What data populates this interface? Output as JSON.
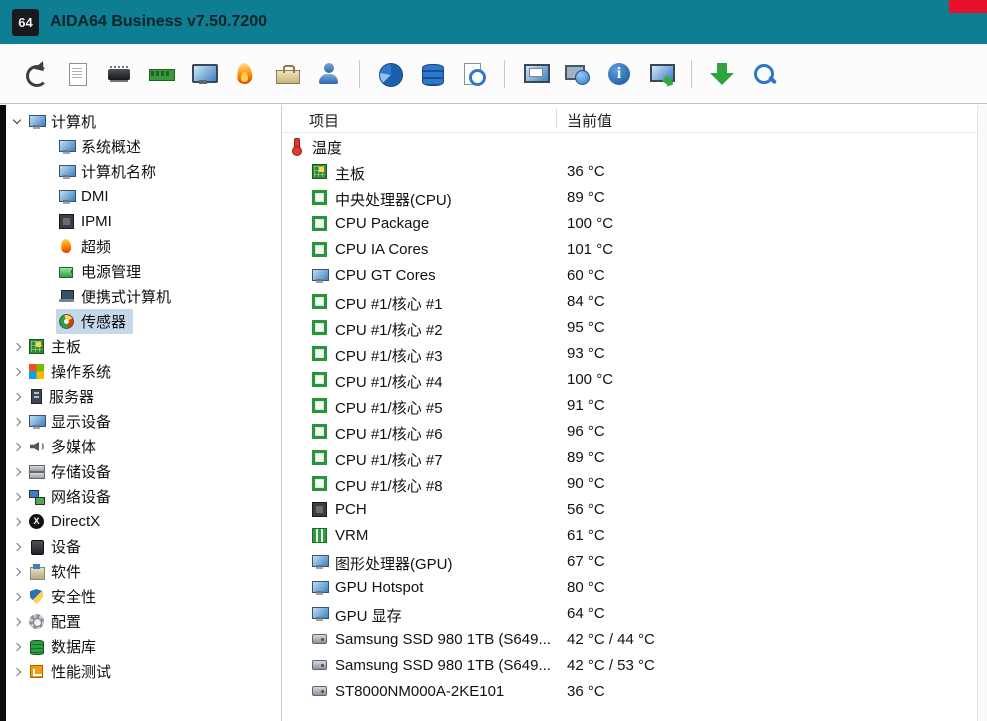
{
  "window": {
    "logo_text": "64",
    "title": "AIDA64 Business v7.50.7200"
  },
  "toolbar": {
    "items": [
      {
        "type": "button",
        "name": "refresh",
        "icon": "refresh-icon"
      },
      {
        "type": "button",
        "name": "report",
        "icon": "report-icon"
      },
      {
        "type": "button",
        "name": "chipset",
        "icon": "chip-icon"
      },
      {
        "type": "button",
        "name": "memory",
        "icon": "memory-module-icon"
      },
      {
        "type": "button",
        "name": "display",
        "icon": "monitor-icon"
      },
      {
        "type": "button",
        "name": "overclock",
        "icon": "flame-icon"
      },
      {
        "type": "button",
        "name": "toolbox",
        "icon": "toolbox-icon"
      },
      {
        "type": "button",
        "name": "users",
        "icon": "users-icon"
      },
      {
        "type": "separator"
      },
      {
        "type": "button",
        "name": "disk",
        "icon": "disk-pie-icon"
      },
      {
        "type": "button",
        "name": "database",
        "icon": "database-icon"
      },
      {
        "type": "button",
        "name": "scheduled-report",
        "icon": "report-clock-icon"
      },
      {
        "type": "separator"
      },
      {
        "type": "button",
        "name": "remote-monitor",
        "icon": "remote-monitor-icon"
      },
      {
        "type": "button",
        "name": "web",
        "icon": "web-globe-icon"
      },
      {
        "type": "button",
        "name": "info",
        "icon": "info-icon"
      },
      {
        "type": "button",
        "name": "remote-control",
        "icon": "monitor-arrow-icon"
      },
      {
        "type": "separator"
      },
      {
        "type": "button",
        "name": "update",
        "icon": "download-arrow-icon"
      },
      {
        "type": "button",
        "name": "search",
        "icon": "search-icon"
      }
    ]
  },
  "sidebar": {
    "items": [
      {
        "id": "computer",
        "label": "计算机",
        "level": 0,
        "arrow": "expanded",
        "icon": "monitor",
        "selected": false
      },
      {
        "id": "system-overview",
        "label": "系统概述",
        "level": 1,
        "arrow": "none",
        "icon": "monitor",
        "selected": false
      },
      {
        "id": "computer-name",
        "label": "计算机名称",
        "level": 1,
        "arrow": "none",
        "icon": "monitor",
        "selected": false
      },
      {
        "id": "dmi",
        "label": "DMI",
        "level": 1,
        "arrow": "none",
        "icon": "monitor",
        "selected": false
      },
      {
        "id": "ipmi",
        "label": "IPMI",
        "level": 1,
        "arrow": "none",
        "icon": "chip",
        "selected": false
      },
      {
        "id": "overclock",
        "label": "超频",
        "level": 1,
        "arrow": "none",
        "icon": "flame",
        "selected": false
      },
      {
        "id": "power-management",
        "label": "电源管理",
        "level": 1,
        "arrow": "none",
        "icon": "power",
        "selected": false
      },
      {
        "id": "portable-computer",
        "label": "便携式计算机",
        "level": 1,
        "arrow": "none",
        "icon": "laptop",
        "selected": false
      },
      {
        "id": "sensors",
        "label": "传感器",
        "level": 1,
        "arrow": "none",
        "icon": "gauge",
        "selected": true
      },
      {
        "id": "motherboard",
        "label": "主板",
        "level": 0,
        "arrow": "collapsed",
        "icon": "board",
        "selected": false
      },
      {
        "id": "operating-system",
        "label": "操作系统",
        "level": 0,
        "arrow": "collapsed",
        "icon": "windows",
        "selected": false
      },
      {
        "id": "server",
        "label": "服务器",
        "level": 0,
        "arrow": "collapsed",
        "icon": "server",
        "selected": false
      },
      {
        "id": "display-devices",
        "label": "显示设备",
        "level": 0,
        "arrow": "collapsed",
        "icon": "monitor",
        "selected": false
      },
      {
        "id": "multimedia",
        "label": "多媒体",
        "level": 0,
        "arrow": "collapsed",
        "icon": "speaker",
        "selected": false
      },
      {
        "id": "storage-devices",
        "label": "存储设备",
        "level": 0,
        "arrow": "collapsed",
        "icon": "disks",
        "selected": false
      },
      {
        "id": "network-devices",
        "label": "网络设备",
        "level": 0,
        "arrow": "collapsed",
        "icon": "network",
        "selected": false
      },
      {
        "id": "directx",
        "label": "DirectX",
        "level": 0,
        "arrow": "collapsed",
        "icon": "directx",
        "selected": false
      },
      {
        "id": "devices",
        "label": "设备",
        "level": 0,
        "arrow": "collapsed",
        "icon": "device",
        "selected": false
      },
      {
        "id": "software",
        "label": "软件",
        "level": 0,
        "arrow": "collapsed",
        "icon": "package",
        "selected": false
      },
      {
        "id": "security",
        "label": "安全性",
        "level": 0,
        "arrow": "collapsed",
        "icon": "shield",
        "selected": false
      },
      {
        "id": "config",
        "label": "配置",
        "level": 0,
        "arrow": "collapsed",
        "icon": "gear",
        "selected": false
      },
      {
        "id": "database",
        "label": "数据库",
        "level": 0,
        "arrow": "collapsed",
        "icon": "dbgreen",
        "selected": false
      },
      {
        "id": "benchmark",
        "label": "性能测试",
        "level": 0,
        "arrow": "collapsed",
        "icon": "chart",
        "selected": false
      }
    ]
  },
  "main": {
    "columns": [
      "项目",
      "当前值"
    ],
    "rows": [
      {
        "label": "温度",
        "value": "",
        "icon": "thermometer",
        "section": true
      },
      {
        "label": "主板",
        "value": "36 °C",
        "icon": "board"
      },
      {
        "label": "中央处理器(CPU)",
        "value": "89 °C",
        "icon": "cpu"
      },
      {
        "label": "CPU Package",
        "value": "100 °C",
        "icon": "cpu"
      },
      {
        "label": "CPU IA Cores",
        "value": "101 °C",
        "icon": "cpu"
      },
      {
        "label": "CPU GT Cores",
        "value": "60 °C",
        "icon": "monitor"
      },
      {
        "label": "CPU #1/核心 #1",
        "value": "84 °C",
        "icon": "cpu"
      },
      {
        "label": "CPU #1/核心 #2",
        "value": "95 °C",
        "icon": "cpu"
      },
      {
        "label": "CPU #1/核心 #3",
        "value": "93 °C",
        "icon": "cpu"
      },
      {
        "label": "CPU #1/核心 #4",
        "value": "100 °C",
        "icon": "cpu"
      },
      {
        "label": "CPU #1/核心 #5",
        "value": "91 °C",
        "icon": "cpu"
      },
      {
        "label": "CPU #1/核心 #6",
        "value": "96 °C",
        "icon": "cpu"
      },
      {
        "label": "CPU #1/核心 #7",
        "value": "89 °C",
        "icon": "cpu"
      },
      {
        "label": "CPU #1/核心 #8",
        "value": "90 °C",
        "icon": "cpu"
      },
      {
        "label": "PCH",
        "value": "56 °C",
        "icon": "chip"
      },
      {
        "label": "VRM",
        "value": "61 °C",
        "icon": "vrm"
      },
      {
        "label": "图形处理器(GPU)",
        "value": "67 °C",
        "icon": "monitor"
      },
      {
        "label": "GPU Hotspot",
        "value": "80 °C",
        "icon": "monitor"
      },
      {
        "label": "GPU 显存",
        "value": "64 °C",
        "icon": "monitor"
      },
      {
        "label": "Samsung SSD 980 1TB (S649...",
        "value": "42 °C / 44 °C",
        "icon": "disk"
      },
      {
        "label": "Samsung SSD 980 1TB (S649...",
        "value": "42 °C / 53 °C",
        "icon": "disk"
      },
      {
        "label": "ST8000NM000A-2KE101",
        "value": "36 °C",
        "icon": "disk"
      }
    ]
  },
  "colors": {
    "titlebar": "#0e7e92",
    "selection": "#c6d9ea",
    "close_button": "#e8112d"
  }
}
